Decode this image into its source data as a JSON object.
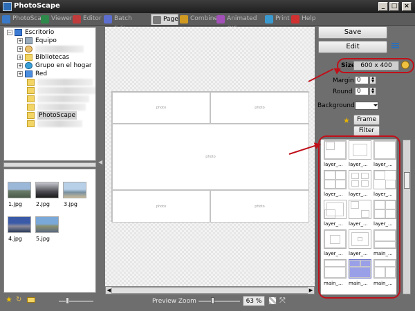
{
  "window": {
    "title": "PhotoScape",
    "minimize": "_",
    "maximize": "□",
    "close": "×"
  },
  "tabs": [
    {
      "label": "PhotoScape",
      "color": "#3a79c8"
    },
    {
      "label": "Viewer",
      "color": "#2e8a4a"
    },
    {
      "label": "Editor",
      "color": "#c03b3b"
    },
    {
      "label": "Batch Editor",
      "color": "#5c6ed0"
    },
    {
      "label": "Page",
      "color": "#7a7a7a"
    },
    {
      "label": "Combine",
      "color": "#d09a22"
    },
    {
      "label": "Animated GIF",
      "color": "#a34fb8"
    },
    {
      "label": "Print",
      "color": "#3a9ad0"
    },
    {
      "label": "Help",
      "color": "#d03030"
    }
  ],
  "active_tab": "Page",
  "tree": {
    "root": "Escritorio",
    "items": [
      "Equipo",
      "",
      "Bibliotecas",
      "Grupo en el hogar",
      "Red"
    ],
    "selected": "PhotoScape"
  },
  "thumbnails": [
    "1.jpg",
    "2.jpg",
    "3.jpg",
    "4.jpg",
    "5.jpg"
  ],
  "canvas": {
    "cell_label": "photo"
  },
  "zoom": {
    "label": "Preview Zoom",
    "value": "63 %"
  },
  "right": {
    "save": "Save",
    "edit": "Edit",
    "size_label": "Size",
    "size_value": "600 x 400",
    "margin_label": "Margin",
    "margin_value": "0",
    "round_label": "Round",
    "round_value": "0",
    "background_label": "Background",
    "frame": "Frame",
    "filter": "Filter"
  },
  "frames": [
    "layer_...",
    "layer_...",
    "layer_...",
    "layer_...",
    "layer_...",
    "layer_...",
    "layer_...",
    "layer_...",
    "layer_...",
    "layer_...",
    "layer_...",
    "main_...",
    "main_...",
    "main_...",
    "main_..."
  ],
  "accent_color": "#c0101a"
}
